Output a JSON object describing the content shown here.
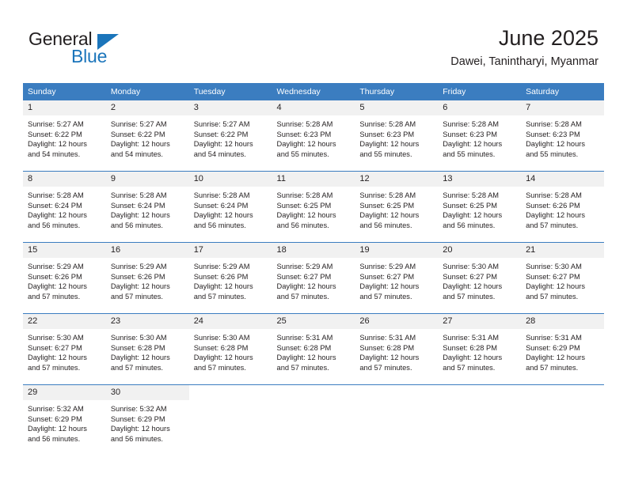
{
  "brand": {
    "name_part1": "General",
    "name_part2": "Blue"
  },
  "header": {
    "title": "June 2025",
    "location": "Dawei, Tanintharyi, Myanmar"
  },
  "weekdays": [
    "Sunday",
    "Monday",
    "Tuesday",
    "Wednesday",
    "Thursday",
    "Friday",
    "Saturday"
  ],
  "colors": {
    "header_blue": "#3b7dc0",
    "brand_blue": "#1b75bb",
    "daynum_bg": "#f1f1f1",
    "text": "#231f20"
  },
  "weeks": [
    [
      {
        "day": "1",
        "sunrise": "Sunrise: 5:27 AM",
        "sunset": "Sunset: 6:22 PM",
        "daylight1": "Daylight: 12 hours",
        "daylight2": "and 54 minutes."
      },
      {
        "day": "2",
        "sunrise": "Sunrise: 5:27 AM",
        "sunset": "Sunset: 6:22 PM",
        "daylight1": "Daylight: 12 hours",
        "daylight2": "and 54 minutes."
      },
      {
        "day": "3",
        "sunrise": "Sunrise: 5:27 AM",
        "sunset": "Sunset: 6:22 PM",
        "daylight1": "Daylight: 12 hours",
        "daylight2": "and 54 minutes."
      },
      {
        "day": "4",
        "sunrise": "Sunrise: 5:28 AM",
        "sunset": "Sunset: 6:23 PM",
        "daylight1": "Daylight: 12 hours",
        "daylight2": "and 55 minutes."
      },
      {
        "day": "5",
        "sunrise": "Sunrise: 5:28 AM",
        "sunset": "Sunset: 6:23 PM",
        "daylight1": "Daylight: 12 hours",
        "daylight2": "and 55 minutes."
      },
      {
        "day": "6",
        "sunrise": "Sunrise: 5:28 AM",
        "sunset": "Sunset: 6:23 PM",
        "daylight1": "Daylight: 12 hours",
        "daylight2": "and 55 minutes."
      },
      {
        "day": "7",
        "sunrise": "Sunrise: 5:28 AM",
        "sunset": "Sunset: 6:23 PM",
        "daylight1": "Daylight: 12 hours",
        "daylight2": "and 55 minutes."
      }
    ],
    [
      {
        "day": "8",
        "sunrise": "Sunrise: 5:28 AM",
        "sunset": "Sunset: 6:24 PM",
        "daylight1": "Daylight: 12 hours",
        "daylight2": "and 56 minutes."
      },
      {
        "day": "9",
        "sunrise": "Sunrise: 5:28 AM",
        "sunset": "Sunset: 6:24 PM",
        "daylight1": "Daylight: 12 hours",
        "daylight2": "and 56 minutes."
      },
      {
        "day": "10",
        "sunrise": "Sunrise: 5:28 AM",
        "sunset": "Sunset: 6:24 PM",
        "daylight1": "Daylight: 12 hours",
        "daylight2": "and 56 minutes."
      },
      {
        "day": "11",
        "sunrise": "Sunrise: 5:28 AM",
        "sunset": "Sunset: 6:25 PM",
        "daylight1": "Daylight: 12 hours",
        "daylight2": "and 56 minutes."
      },
      {
        "day": "12",
        "sunrise": "Sunrise: 5:28 AM",
        "sunset": "Sunset: 6:25 PM",
        "daylight1": "Daylight: 12 hours",
        "daylight2": "and 56 minutes."
      },
      {
        "day": "13",
        "sunrise": "Sunrise: 5:28 AM",
        "sunset": "Sunset: 6:25 PM",
        "daylight1": "Daylight: 12 hours",
        "daylight2": "and 56 minutes."
      },
      {
        "day": "14",
        "sunrise": "Sunrise: 5:28 AM",
        "sunset": "Sunset: 6:26 PM",
        "daylight1": "Daylight: 12 hours",
        "daylight2": "and 57 minutes."
      }
    ],
    [
      {
        "day": "15",
        "sunrise": "Sunrise: 5:29 AM",
        "sunset": "Sunset: 6:26 PM",
        "daylight1": "Daylight: 12 hours",
        "daylight2": "and 57 minutes."
      },
      {
        "day": "16",
        "sunrise": "Sunrise: 5:29 AM",
        "sunset": "Sunset: 6:26 PM",
        "daylight1": "Daylight: 12 hours",
        "daylight2": "and 57 minutes."
      },
      {
        "day": "17",
        "sunrise": "Sunrise: 5:29 AM",
        "sunset": "Sunset: 6:26 PM",
        "daylight1": "Daylight: 12 hours",
        "daylight2": "and 57 minutes."
      },
      {
        "day": "18",
        "sunrise": "Sunrise: 5:29 AM",
        "sunset": "Sunset: 6:27 PM",
        "daylight1": "Daylight: 12 hours",
        "daylight2": "and 57 minutes."
      },
      {
        "day": "19",
        "sunrise": "Sunrise: 5:29 AM",
        "sunset": "Sunset: 6:27 PM",
        "daylight1": "Daylight: 12 hours",
        "daylight2": "and 57 minutes."
      },
      {
        "day": "20",
        "sunrise": "Sunrise: 5:30 AM",
        "sunset": "Sunset: 6:27 PM",
        "daylight1": "Daylight: 12 hours",
        "daylight2": "and 57 minutes."
      },
      {
        "day": "21",
        "sunrise": "Sunrise: 5:30 AM",
        "sunset": "Sunset: 6:27 PM",
        "daylight1": "Daylight: 12 hours",
        "daylight2": "and 57 minutes."
      }
    ],
    [
      {
        "day": "22",
        "sunrise": "Sunrise: 5:30 AM",
        "sunset": "Sunset: 6:27 PM",
        "daylight1": "Daylight: 12 hours",
        "daylight2": "and 57 minutes."
      },
      {
        "day": "23",
        "sunrise": "Sunrise: 5:30 AM",
        "sunset": "Sunset: 6:28 PM",
        "daylight1": "Daylight: 12 hours",
        "daylight2": "and 57 minutes."
      },
      {
        "day": "24",
        "sunrise": "Sunrise: 5:30 AM",
        "sunset": "Sunset: 6:28 PM",
        "daylight1": "Daylight: 12 hours",
        "daylight2": "and 57 minutes."
      },
      {
        "day": "25",
        "sunrise": "Sunrise: 5:31 AM",
        "sunset": "Sunset: 6:28 PM",
        "daylight1": "Daylight: 12 hours",
        "daylight2": "and 57 minutes."
      },
      {
        "day": "26",
        "sunrise": "Sunrise: 5:31 AM",
        "sunset": "Sunset: 6:28 PM",
        "daylight1": "Daylight: 12 hours",
        "daylight2": "and 57 minutes."
      },
      {
        "day": "27",
        "sunrise": "Sunrise: 5:31 AM",
        "sunset": "Sunset: 6:28 PM",
        "daylight1": "Daylight: 12 hours",
        "daylight2": "and 57 minutes."
      },
      {
        "day": "28",
        "sunrise": "Sunrise: 5:31 AM",
        "sunset": "Sunset: 6:29 PM",
        "daylight1": "Daylight: 12 hours",
        "daylight2": "and 57 minutes."
      }
    ],
    [
      {
        "day": "29",
        "sunrise": "Sunrise: 5:32 AM",
        "sunset": "Sunset: 6:29 PM",
        "daylight1": "Daylight: 12 hours",
        "daylight2": "and 56 minutes."
      },
      {
        "day": "30",
        "sunrise": "Sunrise: 5:32 AM",
        "sunset": "Sunset: 6:29 PM",
        "daylight1": "Daylight: 12 hours",
        "daylight2": "and 56 minutes."
      },
      {
        "day": "",
        "sunrise": "",
        "sunset": "",
        "daylight1": "",
        "daylight2": ""
      },
      {
        "day": "",
        "sunrise": "",
        "sunset": "",
        "daylight1": "",
        "daylight2": ""
      },
      {
        "day": "",
        "sunrise": "",
        "sunset": "",
        "daylight1": "",
        "daylight2": ""
      },
      {
        "day": "",
        "sunrise": "",
        "sunset": "",
        "daylight1": "",
        "daylight2": ""
      },
      {
        "day": "",
        "sunrise": "",
        "sunset": "",
        "daylight1": "",
        "daylight2": ""
      }
    ]
  ]
}
